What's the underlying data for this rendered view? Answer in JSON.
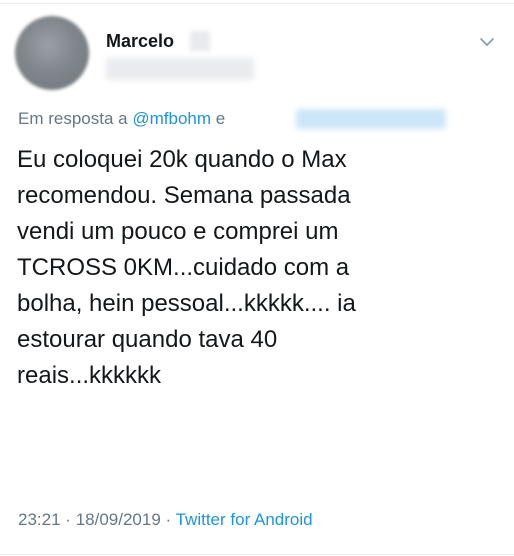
{
  "tweet": {
    "author_name": "Marcelo",
    "reply_prefix": "Em resposta a",
    "reply_mention": "@mfbohm",
    "reply_conjunction": "e",
    "text": "Eu coloquei 20k quando o Max\nrecomendou. Semana passada\nvendi um pouco e comprei um\nTCROSS 0KM...cuidado com a\nbolha, hein pessoal...kkkkk.... ia\nestourar quando tava 40\nreais...kkkkkk",
    "time": "23:21",
    "separator": "·",
    "date": "18/09/2019",
    "source": "Twitter for Android",
    "menu_icon": "chevron-down-icon"
  },
  "colors": {
    "text": "#14171a",
    "muted": "#657786",
    "link": "#1b95e0",
    "divider": "#e6ecf0"
  }
}
